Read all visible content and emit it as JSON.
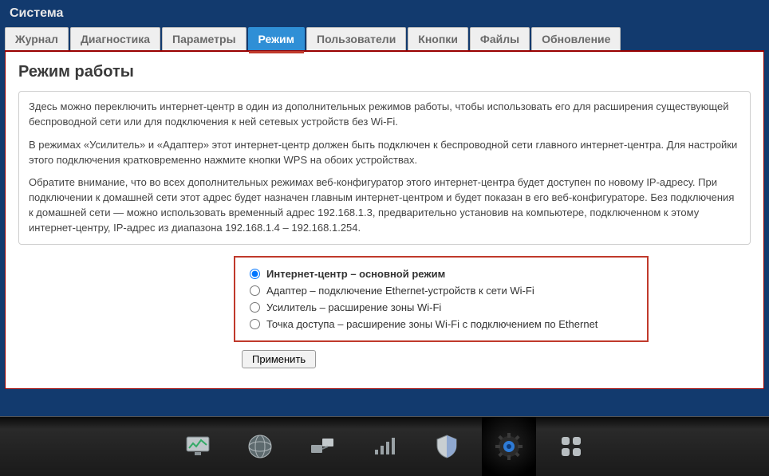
{
  "header": {
    "title": "Система"
  },
  "tabs": {
    "items": [
      {
        "label": "Журнал"
      },
      {
        "label": "Диагностика"
      },
      {
        "label": "Параметры"
      },
      {
        "label": "Режим"
      },
      {
        "label": "Пользователи"
      },
      {
        "label": "Кнопки"
      },
      {
        "label": "Файлы"
      },
      {
        "label": "Обновление"
      }
    ],
    "active_index": 3
  },
  "panel": {
    "title": "Режим работы",
    "para1": "Здесь можно переключить интернет-центр в один из дополнительных режимов работы, чтобы использовать его для расширения существующей беспроводной сети или для подключения к ней сетевых устройств без Wi-Fi.",
    "para2": "В режимах «Усилитель» и «Адаптер» этот интернет-центр должен быть подключен к беспроводной сети главного интернет-центра. Для настройки этого подключения кратковременно нажмите кнопки WPS на обоих устройствах.",
    "para3": "Обратите внимание, что во всех дополнительных режимах веб-конфигуратор этого интернет-центра будет доступен по новому IP-адресу. При подключении к домашней сети этот адрес будет назначен главным интернет-центром и будет показан в его веб-конфигураторе. Без подключения к домашней сети — можно использовать временный адрес 192.168.1.3, предварительно установив на компьютере, подключенном к этому интернет-центру, IP-адрес из диапазона 192.168.1.4 – 192.168.1.254."
  },
  "modes": {
    "items": [
      {
        "label": "Интернет-центр – основной режим",
        "selected": true
      },
      {
        "label": "Адаптер – подключение Ethernet-устройств к сети Wi-Fi",
        "selected": false
      },
      {
        "label": "Усилитель – расширение зоны Wi-Fi",
        "selected": false
      },
      {
        "label": "Точка доступа – расширение зоны Wi-Fi с подключением по Ethernet",
        "selected": false
      }
    ]
  },
  "buttons": {
    "apply": "Применить"
  },
  "footer_icons": [
    "monitor-icon",
    "globe-icon",
    "network-icon",
    "signal-icon",
    "shield-icon",
    "gear-icon",
    "apps-icon"
  ]
}
